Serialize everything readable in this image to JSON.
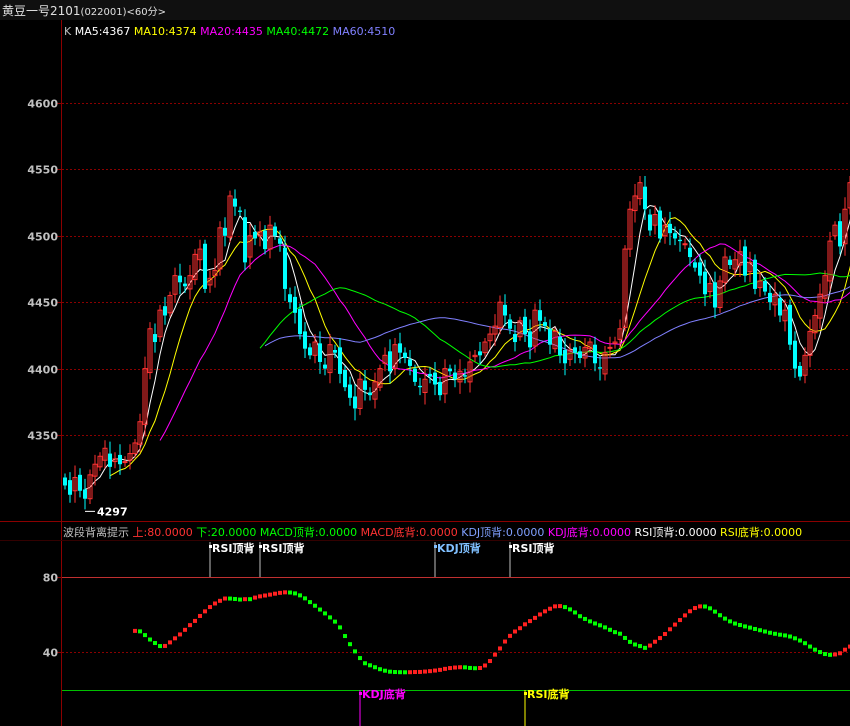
{
  "header": {
    "title": "黄豆一号2101",
    "code": "(022001)",
    "period": "<60分>"
  },
  "colors": {
    "up": "#ff3232",
    "down": "#00ffff",
    "ma5": "#ffffff",
    "ma10": "#ffff00",
    "ma20": "#ff00ff",
    "ma40": "#00ff00",
    "ma60": "#8080ff",
    "grid": "#8b0000",
    "axis_text": "#c0c0c0",
    "frame": "#8b0000"
  },
  "chart_data": [
    {
      "type": "candlestick",
      "legend": [
        {
          "key": "k",
          "text": "K",
          "color": "#c0c0c0"
        },
        {
          "key": "ma5",
          "text": "MA5:4367",
          "color": "#ffffff"
        },
        {
          "key": "ma10",
          "text": "MA10:4374",
          "color": "#ffff00"
        },
        {
          "key": "ma20",
          "text": "MA20:4435",
          "color": "#ff00ff"
        },
        {
          "key": "ma40",
          "text": "MA40:4472",
          "color": "#00ff00"
        },
        {
          "key": "ma60",
          "text": "MA60:4510",
          "color": "#8080ff"
        }
      ],
      "y_ticks": [
        4600,
        4550,
        4500,
        4450,
        4400,
        4350
      ],
      "ylim": [
        4285,
        4650
      ],
      "low_label": "4297",
      "close": [
        4312,
        4305,
        4318,
        4308,
        4302,
        4320,
        4328,
        4334,
        4340,
        4326,
        4332,
        4328,
        4330,
        4336,
        4344,
        4360,
        4400,
        4430,
        4420,
        4444,
        4440,
        4455,
        4470,
        4465,
        4462,
        4470,
        4486,
        4490,
        4460,
        4468,
        4474,
        4506,
        4500,
        4530,
        4522,
        4518,
        4480,
        4500,
        4498,
        4503,
        4490,
        4508,
        4500,
        4494,
        4460,
        4450,
        4442,
        4426,
        4415,
        4410,
        4420,
        4405,
        4400,
        4418,
        4412,
        4396,
        4386,
        4378,
        4370,
        4392,
        4384,
        4380,
        4390,
        4400,
        4410,
        4398,
        4418,
        4412,
        4408,
        4402,
        4390,
        4386,
        4392,
        4394,
        4388,
        4380,
        4400,
        4398,
        4392,
        4398,
        4394,
        4405,
        4410,
        4410,
        4420,
        4426,
        4432,
        4450,
        4440,
        4430,
        4420,
        4436,
        4426,
        4416,
        4444,
        4436,
        4432,
        4418,
        4428,
        4410,
        4404,
        4414,
        4412,
        4408,
        4416,
        4420,
        4404,
        4400,
        4412,
        4416,
        4420,
        4430,
        4490,
        4520,
        4530,
        4540,
        4520,
        4504,
        4516,
        4498,
        4508,
        4502,
        4498,
        4496,
        4494,
        4484,
        4476,
        4470,
        4456,
        4464,
        4446,
        4466,
        4484,
        4478,
        4482,
        4488,
        4470,
        4480,
        4460,
        4466,
        4458,
        4450,
        4456,
        4440,
        4444,
        4418,
        4400,
        4394,
        4410,
        4428,
        4440,
        4456,
        4470,
        4496,
        4508,
        4492,
        4520,
        4540,
        4560,
        4590
      ]
    },
    {
      "type": "indicator",
      "legend": [
        {
          "key": "name",
          "text": "波段背离提示",
          "color": "#c0c0c0"
        },
        {
          "key": "up",
          "text": "上:80.0000",
          "color": "#ff3232"
        },
        {
          "key": "down",
          "text": "下:20.0000",
          "color": "#00ff00"
        },
        {
          "key": "macd_top",
          "text": "MACD顶背:0.0000",
          "color": "#00ff00"
        },
        {
          "key": "macd_bottom",
          "text": "MACD底背:0.0000",
          "color": "#ff3232"
        },
        {
          "key": "kdj_top",
          "text": "KDJ顶背:0.0000",
          "color": "#80a0ff"
        },
        {
          "key": "kdj_bottom",
          "text": "KDJ底背:0.0000",
          "color": "#ff00ff"
        },
        {
          "key": "rsi_top",
          "text": "RSI顶背:0.0000",
          "color": "#ffffff"
        },
        {
          "key": "rsi_bottom",
          "text": "RSI底背:0.0000",
          "color": "#ffff00"
        }
      ],
      "y_ticks": [
        80,
        40
      ],
      "upper_level": 80,
      "lower_level": 20,
      "markers": [
        {
          "index": 29,
          "text": "RSI顶背",
          "kind": "top",
          "color": "#ffffff"
        },
        {
          "index": 39,
          "text": "RSI顶背",
          "kind": "top",
          "color": "#ffffff"
        },
        {
          "index": 74,
          "text": "KDJ顶背",
          "kind": "top",
          "color": "#80c0ff"
        },
        {
          "index": 89,
          "text": "RSI顶背",
          "kind": "top",
          "color": "#ffffff"
        },
        {
          "index": 59,
          "text": "KDJ底背",
          "kind": "bottom",
          "color": "#ff00ff"
        },
        {
          "index": 92,
          "text": "RSI底背",
          "kind": "bottom",
          "color": "#ffff00"
        }
      ]
    }
  ]
}
